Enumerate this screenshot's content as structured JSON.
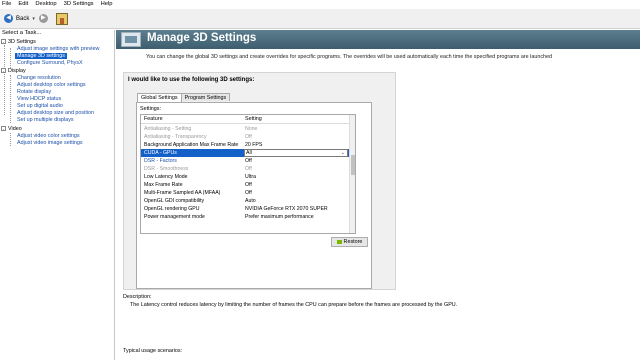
{
  "menubar": {
    "items": [
      "File",
      "Edit",
      "Desktop",
      "3D Settings",
      "Help"
    ]
  },
  "toolbar": {
    "back_label": "Back",
    "back_icon": "arrow-left-icon",
    "forward_icon": "arrow-right-icon",
    "home_icon": "home-icon"
  },
  "sidebar": {
    "title": "Select a Task...",
    "categories": [
      {
        "label": "3D Settings",
        "items": [
          "Adjust image settings with preview",
          "Manage 3D settings",
          "Configure Surround, PhysX"
        ]
      },
      {
        "label": "Display",
        "items": [
          "Change resolution",
          "Adjust desktop color settings",
          "Rotate display",
          "View HDCP status",
          "Set up digital audio",
          "Adjust desktop size and position",
          "Set up multiple displays"
        ]
      },
      {
        "label": "Video",
        "items": [
          "Adjust video color settings",
          "Adjust video image settings"
        ]
      }
    ],
    "selected": "Manage 3D settings"
  },
  "header": {
    "title": "Manage 3D Settings",
    "description": "You can change the global 3D settings and create overrides for specific programs. The overrides will be used automatically each time the specified programs are launched"
  },
  "panel": {
    "heading": "I would like to use the following 3D settings:",
    "tabs": [
      "Global Settings",
      "Program Settings"
    ],
    "active_tab": "Global Settings",
    "settings_label": "Settings:",
    "columns": [
      "Feature",
      "Setting"
    ],
    "rows": [
      {
        "feature": "Antialiasing - Setting",
        "setting": "None",
        "state": "dim"
      },
      {
        "feature": "Antialiasing - Transparency",
        "setting": "Off",
        "state": "dim"
      },
      {
        "feature": "Background Application Max Frame Rate",
        "setting": "20 FPS",
        "state": "normal"
      },
      {
        "feature": "CUDA - GPUs",
        "setting": "All",
        "state": "selected"
      },
      {
        "feature": "DSR - Factors",
        "setting": "Off",
        "state": "link"
      },
      {
        "feature": "DSR - Smoothness",
        "setting": "Off",
        "state": "dim"
      },
      {
        "feature": "Low Latency Mode",
        "setting": "Ultra",
        "state": "normal"
      },
      {
        "feature": "Max Frame Rate",
        "setting": "Off",
        "state": "normal"
      },
      {
        "feature": "Multi-Frame Sampled AA (MFAA)",
        "setting": "Off",
        "state": "normal"
      },
      {
        "feature": "OpenGL GDI compatibility",
        "setting": "Auto",
        "state": "normal"
      },
      {
        "feature": "OpenGL rendering GPU",
        "setting": "NVIDIA GeForce RTX 2070 SUPER",
        "state": "normal"
      },
      {
        "feature": "Power management mode",
        "setting": "Prefer maximum performance",
        "state": "normal"
      }
    ],
    "restore_label": "Restore",
    "colors": {
      "selection": "#1460c9",
      "link": "#1d4fa8",
      "banner": "#4a6b7d"
    }
  },
  "description": {
    "label": "Description:",
    "body": "The Latency control reduces latency by limiting the number of frames the CPU can prepare before the frames are processed by the GPU."
  },
  "usage": {
    "label": "Typical usage scenarios:"
  }
}
